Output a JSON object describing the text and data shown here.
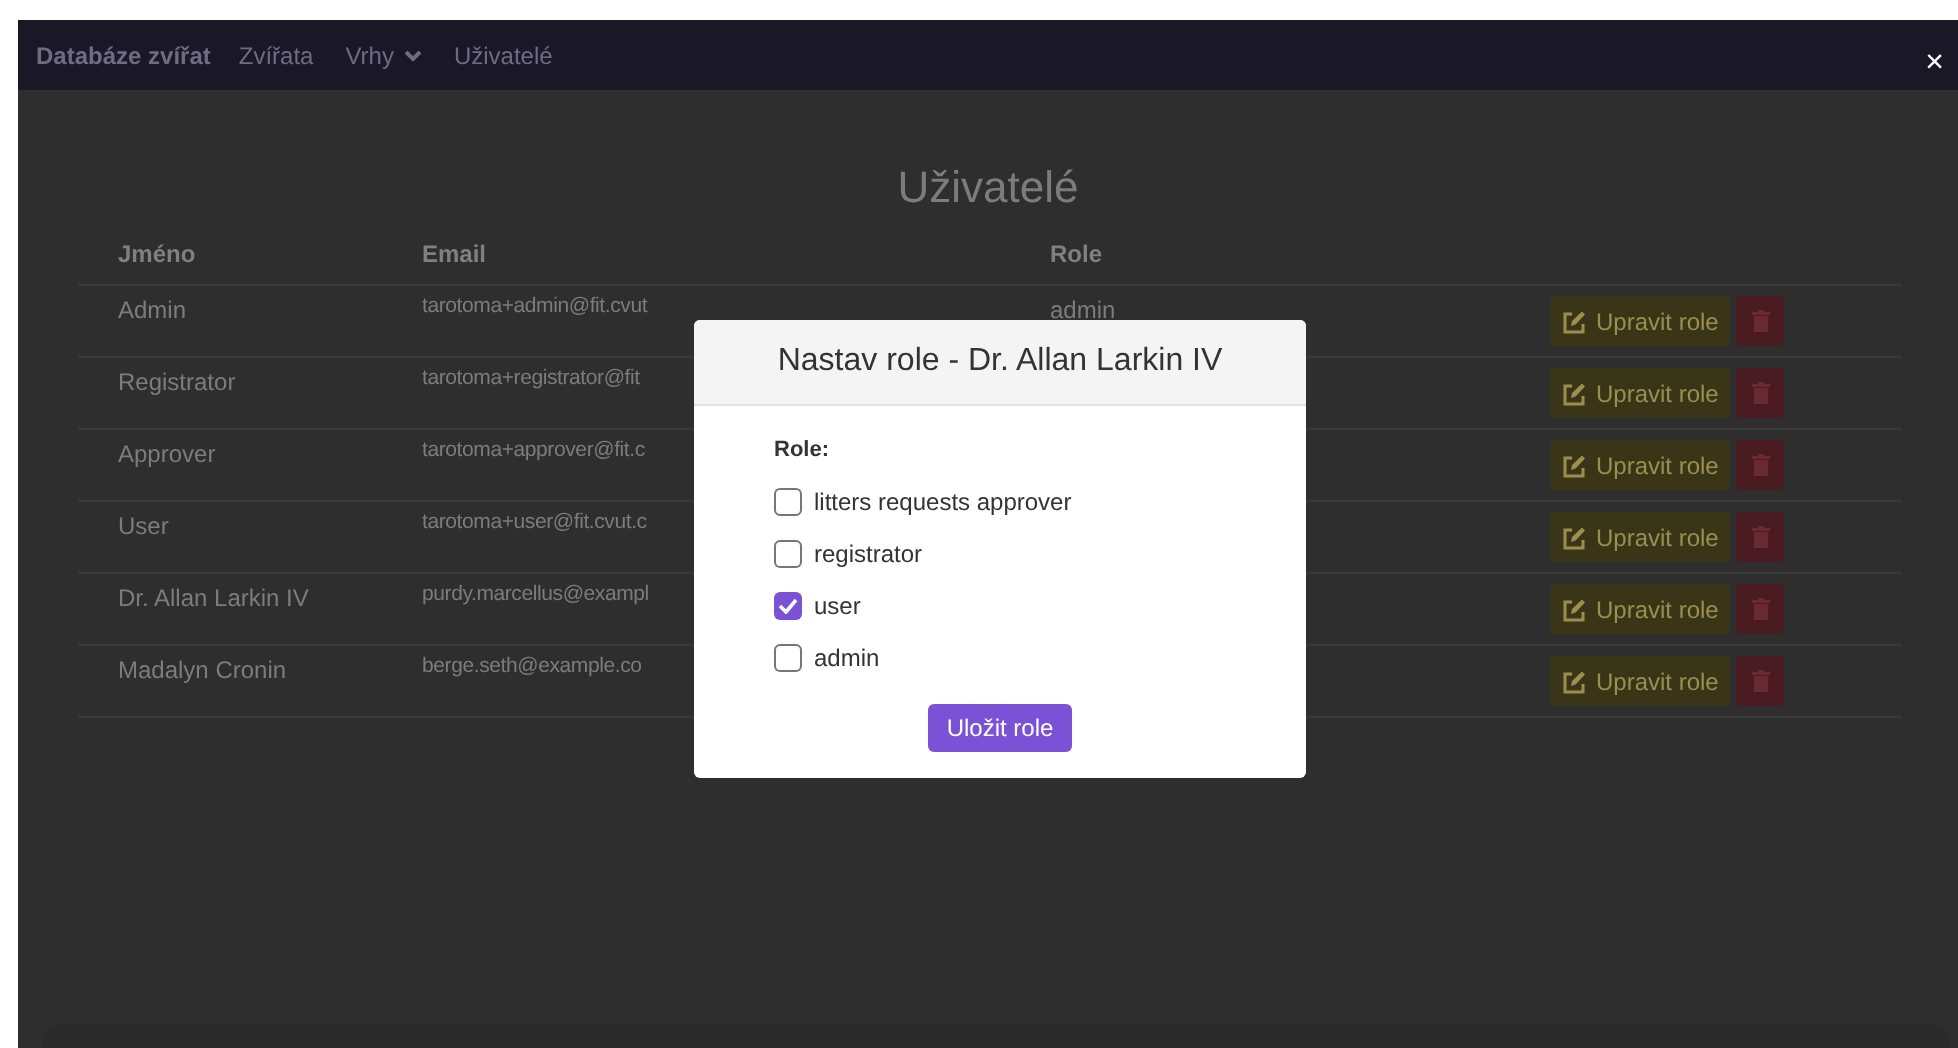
{
  "navbar": {
    "brand": "Databáze zvířat",
    "links": [
      {
        "label": "Zvířata",
        "kind": "link"
      },
      {
        "label": "Vrhy",
        "kind": "dropdown"
      },
      {
        "label": "Uživatelé",
        "kind": "link"
      }
    ]
  },
  "close_symbol": "×",
  "page_title": "Uživatelé",
  "table": {
    "columns": [
      "Jméno",
      "Email",
      "Role"
    ],
    "rows": [
      {
        "name": "Admin",
        "email": "tarotoma+admin@fit.cvut",
        "role": "admin",
        "edit": "Upravit role"
      },
      {
        "name": "Registrator",
        "email": "tarotoma+registrator@fit",
        "edit": "Upravit role"
      },
      {
        "name": "Approver",
        "email": "tarotoma+approver@fit.c",
        "edit": "Upravit role"
      },
      {
        "name": "User",
        "email": "tarotoma+user@fit.cvut.c",
        "edit": "Upravit role"
      },
      {
        "name": "Dr. Allan Larkin IV",
        "email": "purdy.marcellus@exampl",
        "edit": "Upravit role"
      },
      {
        "name": "Madalyn Cronin",
        "email": "berge.seth@example.co",
        "edit": "Upravit role"
      }
    ]
  },
  "modal": {
    "title": "Nastav role - Dr. Allan Larkin IV",
    "label": "Role:",
    "options": [
      {
        "label": "litters requests approver",
        "checked": false
      },
      {
        "label": "registrator",
        "checked": false
      },
      {
        "label": "user",
        "checked": true
      },
      {
        "label": "admin",
        "checked": false
      }
    ],
    "save_button": "Uložit role"
  }
}
